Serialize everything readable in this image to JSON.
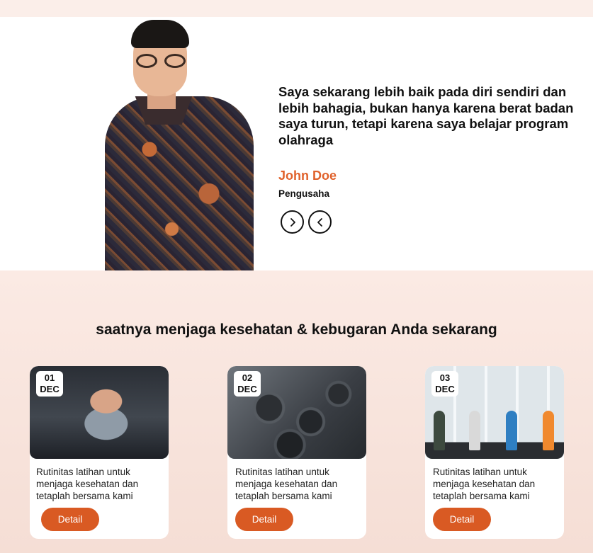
{
  "testimonial": {
    "quote": "Saya sekarang lebih baik pada diri sendiri dan lebih bahagia, bukan hanya karena berat badan saya turun, tetapi karena saya belajar program olahraga",
    "author_name": "John Doe",
    "author_role": "Pengusaha",
    "next_icon": "chevron-right-icon",
    "prev_icon": "chevron-left-icon",
    "accent_color": "#e0622c"
  },
  "section": {
    "title": "saatnya menjaga kesehatan & kebugaran Anda sekarang"
  },
  "cards": [
    {
      "day": "01",
      "month": "DEC",
      "description": "Rutinitas latihan untuk menjaga kesehatan dan tetaplah bersama kami",
      "button": "Detail"
    },
    {
      "day": "02",
      "month": "DEC",
      "description": "Rutinitas latihan untuk menjaga kesehatan dan tetaplah bersama kami",
      "button": "Detail"
    },
    {
      "day": "03",
      "month": "DEC",
      "description": "Rutinitas latihan untuk menjaga kesehatan dan tetaplah bersama kami",
      "button": "Detail"
    }
  ],
  "button_color": "#d95a23"
}
